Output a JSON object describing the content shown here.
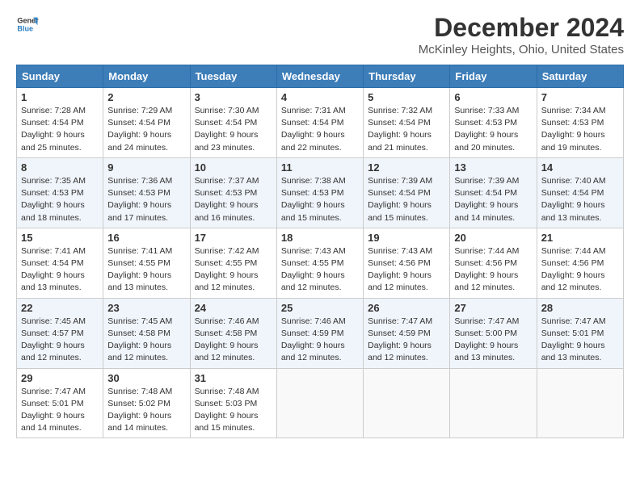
{
  "header": {
    "logo_line1": "General",
    "logo_line2": "Blue",
    "month_title": "December 2024",
    "location": "McKinley Heights, Ohio, United States"
  },
  "weekdays": [
    "Sunday",
    "Monday",
    "Tuesday",
    "Wednesday",
    "Thursday",
    "Friday",
    "Saturday"
  ],
  "weeks": [
    [
      {
        "day": "1",
        "sunrise": "7:28 AM",
        "sunset": "4:54 PM",
        "daylight": "9 hours and 25 minutes."
      },
      {
        "day": "2",
        "sunrise": "7:29 AM",
        "sunset": "4:54 PM",
        "daylight": "9 hours and 24 minutes."
      },
      {
        "day": "3",
        "sunrise": "7:30 AM",
        "sunset": "4:54 PM",
        "daylight": "9 hours and 23 minutes."
      },
      {
        "day": "4",
        "sunrise": "7:31 AM",
        "sunset": "4:54 PM",
        "daylight": "9 hours and 22 minutes."
      },
      {
        "day": "5",
        "sunrise": "7:32 AM",
        "sunset": "4:54 PM",
        "daylight": "9 hours and 21 minutes."
      },
      {
        "day": "6",
        "sunrise": "7:33 AM",
        "sunset": "4:53 PM",
        "daylight": "9 hours and 20 minutes."
      },
      {
        "day": "7",
        "sunrise": "7:34 AM",
        "sunset": "4:53 PM",
        "daylight": "9 hours and 19 minutes."
      }
    ],
    [
      {
        "day": "8",
        "sunrise": "7:35 AM",
        "sunset": "4:53 PM",
        "daylight": "9 hours and 18 minutes."
      },
      {
        "day": "9",
        "sunrise": "7:36 AM",
        "sunset": "4:53 PM",
        "daylight": "9 hours and 17 minutes."
      },
      {
        "day": "10",
        "sunrise": "7:37 AM",
        "sunset": "4:53 PM",
        "daylight": "9 hours and 16 minutes."
      },
      {
        "day": "11",
        "sunrise": "7:38 AM",
        "sunset": "4:53 PM",
        "daylight": "9 hours and 15 minutes."
      },
      {
        "day": "12",
        "sunrise": "7:39 AM",
        "sunset": "4:54 PM",
        "daylight": "9 hours and 15 minutes."
      },
      {
        "day": "13",
        "sunrise": "7:39 AM",
        "sunset": "4:54 PM",
        "daylight": "9 hours and 14 minutes."
      },
      {
        "day": "14",
        "sunrise": "7:40 AM",
        "sunset": "4:54 PM",
        "daylight": "9 hours and 13 minutes."
      }
    ],
    [
      {
        "day": "15",
        "sunrise": "7:41 AM",
        "sunset": "4:54 PM",
        "daylight": "9 hours and 13 minutes."
      },
      {
        "day": "16",
        "sunrise": "7:41 AM",
        "sunset": "4:55 PM",
        "daylight": "9 hours and 13 minutes."
      },
      {
        "day": "17",
        "sunrise": "7:42 AM",
        "sunset": "4:55 PM",
        "daylight": "9 hours and 12 minutes."
      },
      {
        "day": "18",
        "sunrise": "7:43 AM",
        "sunset": "4:55 PM",
        "daylight": "9 hours and 12 minutes."
      },
      {
        "day": "19",
        "sunrise": "7:43 AM",
        "sunset": "4:56 PM",
        "daylight": "9 hours and 12 minutes."
      },
      {
        "day": "20",
        "sunrise": "7:44 AM",
        "sunset": "4:56 PM",
        "daylight": "9 hours and 12 minutes."
      },
      {
        "day": "21",
        "sunrise": "7:44 AM",
        "sunset": "4:56 PM",
        "daylight": "9 hours and 12 minutes."
      }
    ],
    [
      {
        "day": "22",
        "sunrise": "7:45 AM",
        "sunset": "4:57 PM",
        "daylight": "9 hours and 12 minutes."
      },
      {
        "day": "23",
        "sunrise": "7:45 AM",
        "sunset": "4:58 PM",
        "daylight": "9 hours and 12 minutes."
      },
      {
        "day": "24",
        "sunrise": "7:46 AM",
        "sunset": "4:58 PM",
        "daylight": "9 hours and 12 minutes."
      },
      {
        "day": "25",
        "sunrise": "7:46 AM",
        "sunset": "4:59 PM",
        "daylight": "9 hours and 12 minutes."
      },
      {
        "day": "26",
        "sunrise": "7:47 AM",
        "sunset": "4:59 PM",
        "daylight": "9 hours and 12 minutes."
      },
      {
        "day": "27",
        "sunrise": "7:47 AM",
        "sunset": "5:00 PM",
        "daylight": "9 hours and 13 minutes."
      },
      {
        "day": "28",
        "sunrise": "7:47 AM",
        "sunset": "5:01 PM",
        "daylight": "9 hours and 13 minutes."
      }
    ],
    [
      {
        "day": "29",
        "sunrise": "7:47 AM",
        "sunset": "5:01 PM",
        "daylight": "9 hours and 14 minutes."
      },
      {
        "day": "30",
        "sunrise": "7:48 AM",
        "sunset": "5:02 PM",
        "daylight": "9 hours and 14 minutes."
      },
      {
        "day": "31",
        "sunrise": "7:48 AM",
        "sunset": "5:03 PM",
        "daylight": "9 hours and 15 minutes."
      },
      null,
      null,
      null,
      null
    ]
  ],
  "labels": {
    "sunrise": "Sunrise:",
    "sunset": "Sunset:",
    "daylight": "Daylight:"
  }
}
